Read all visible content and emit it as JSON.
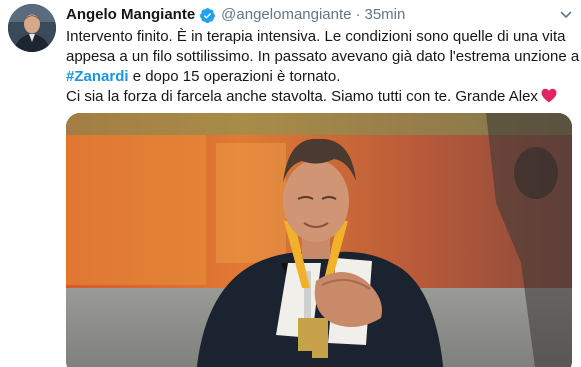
{
  "tweet": {
    "display_name": "Angelo Mangiante",
    "handle": "@angelomangiante",
    "separator": "·",
    "time": "35min",
    "verified": true,
    "text": {
      "line1": "Intervento finito. È in terapia intensiva. Le condizioni sono quelle di una vita",
      "line2": "appesa a un filo sottilissimo. In passato avevano già dato l'estrema unzione a",
      "hashtag": "#Zanardi",
      "line3_rest": " e dopo 15 operazioni è tornato.",
      "line4": "Ci sia la forza di farcela anche stavolta. Siamo tutti con te. Grande Alex"
    },
    "icons": {
      "verified": "verified-badge-icon",
      "more": "chevron-down-icon",
      "heart": "red-heart-emoji"
    },
    "colors": {
      "link": "#1b95e0",
      "verified": "#1da1f2",
      "heart": "#e0245e",
      "text": "#14171a",
      "secondary": "#657786"
    }
  }
}
